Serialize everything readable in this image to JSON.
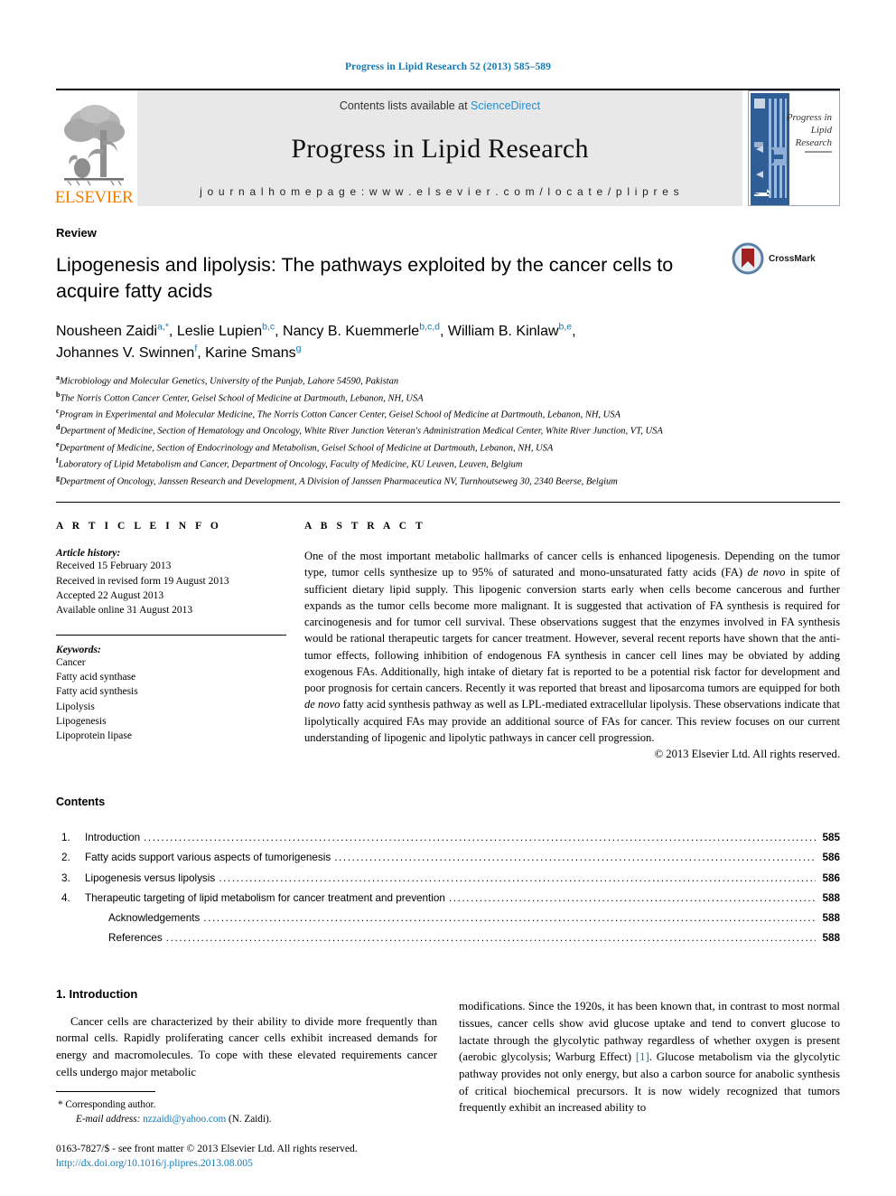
{
  "running_head": "Progress in Lipid Research 52 (2013) 585–589",
  "masthead": {
    "contents_prefix": "Contents lists available at ",
    "sciencedirect": "ScienceDirect",
    "journal_title": "Progress in Lipid Research",
    "homepage": "j o u r n a l   h o m e p a g e :   w w w . e l s e v i e r . c o m / l o c a t e / p l i p r e s",
    "publisher_word": "ELSEVIER",
    "cover_title_line1": "Progress in",
    "cover_title_line2": "Lipid",
    "cover_title_line3": "Research"
  },
  "article": {
    "doctype": "Review",
    "title": "Lipogenesis and lipolysis: The pathways exploited by the cancer cells to acquire fatty acids",
    "crossmark_label": "CrossMark",
    "authors": [
      {
        "name": "Nousheen Zaidi",
        "marks": "a,*",
        "sep": ", "
      },
      {
        "name": "Leslie Lupien",
        "marks": "b,c",
        "sep": ", "
      },
      {
        "name": "Nancy B. Kuemmerle",
        "marks": "b,c,d",
        "sep": ", "
      },
      {
        "name": "William B. Kinlaw",
        "marks": "b,e",
        "sep": ", "
      },
      {
        "name": "Johannes V. Swinnen",
        "marks": "f",
        "sep": ", "
      },
      {
        "name": "Karine Smans",
        "marks": "g",
        "sep": ""
      }
    ],
    "affiliations": [
      {
        "mark": "a",
        "text": "Microbiology and Molecular Genetics, University of the Punjab, Lahore 54590, Pakistan"
      },
      {
        "mark": "b",
        "text": "The Norris Cotton Cancer Center, Geisel School of Medicine at Dartmouth, Lebanon, NH, USA"
      },
      {
        "mark": "c",
        "text": "Program in Experimental and Molecular Medicine, The Norris Cotton Cancer Center, Geisel School of Medicine at Dartmouth, Lebanon, NH, USA"
      },
      {
        "mark": "d",
        "text": "Department of Medicine, Section of Hematology and Oncology, White River Junction Veteran's Administration Medical Center, White River Junction, VT, USA"
      },
      {
        "mark": "e",
        "text": "Department of Medicine, Section of Endocrinology and Metabolism, Geisel School of Medicine at Dartmouth, Lebanon, NH, USA"
      },
      {
        "mark": "f",
        "text": "Laboratory of Lipid Metabolism and Cancer, Department of Oncology, Faculty of Medicine, KU Leuven, Leuven, Belgium"
      },
      {
        "mark": "g",
        "text": "Department of Oncology, Janssen Research and Development, A Division of Janssen Pharmaceutica NV, Turnhoutseweg 30, 2340 Beerse, Belgium"
      }
    ]
  },
  "article_info": {
    "section_label": "A R T I C L E  I N F O",
    "history_title": "Article history:",
    "history": [
      "Received 15 February 2013",
      "Received in revised form 19 August 2013",
      "Accepted 22 August 2013",
      "Available online 31 August 2013"
    ],
    "keywords_title": "Keywords:",
    "keywords": [
      "Cancer",
      "Fatty acid synthase",
      "Fatty acid synthesis",
      "Lipolysis",
      "Lipogenesis",
      "Lipoprotein lipase"
    ]
  },
  "abstract": {
    "section_label": "A B S T R A C T",
    "part1": "One of the most important metabolic hallmarks of cancer cells is enhanced lipogenesis. Depending on the tumor type, tumor cells synthesize up to 95% of saturated and mono-unsaturated fatty acids (FA) ",
    "italic1": "de novo",
    "part2": " in spite of sufficient dietary lipid supply. This lipogenic conversion starts early when cells become cancerous and further expands as the tumor cells become more malignant. It is suggested that activation of FA synthesis is required for carcinogenesis and for tumor cell survival. These observations suggest that the enzymes involved in FA synthesis would be rational therapeutic targets for cancer treatment. However, several recent reports have shown that the anti-tumor effects, following inhibition of endogenous FA synthesis in cancer cell lines may be obviated by adding exogenous FAs. Additionally, high intake of dietary fat is reported to be a potential risk factor for development and poor prognosis for certain cancers. Recently it was reported that breast and liposarcoma tumors are equipped for both ",
    "italic2": "de novo",
    "part3": " fatty acid synthesis pathway as well as LPL-mediated extracellular lipolysis. These observations indicate that lipolytically acquired FAs may provide an additional source of FAs for cancer. This review focuses on our current understanding of lipogenic and lipolytic pathways in cancer cell progression.",
    "copyright": "© 2013 Elsevier Ltd. All rights reserved."
  },
  "contents": {
    "heading": "Contents",
    "rows": [
      {
        "num": "1.",
        "label": "Introduction",
        "page": "585",
        "indent": false
      },
      {
        "num": "2.",
        "label": "Fatty acids support various aspects of tumorigenesis",
        "page": "586",
        "indent": false
      },
      {
        "num": "3.",
        "label": "Lipogenesis versus lipolysis",
        "page": "586",
        "indent": false
      },
      {
        "num": "4.",
        "label": "Therapeutic targeting of lipid metabolism for cancer treatment and prevention",
        "page": "588",
        "indent": false
      },
      {
        "num": "",
        "label": "Acknowledgements",
        "page": "588",
        "indent": true
      },
      {
        "num": "",
        "label": "References",
        "page": "588",
        "indent": true
      }
    ]
  },
  "body": {
    "section_heading": "1. Introduction",
    "left_paragraph": "Cancer cells are characterized by their ability to divide more frequently than normal cells. Rapidly proliferating cancer cells exhibit increased demands for energy and macromolecules. To cope with these elevated requirements cancer cells undergo major metabolic",
    "right_part1": "modifications. Since the 1920s, it has been known that, in contrast to most normal tissues, cancer cells show avid glucose uptake and tend to convert glucose to lactate through the glycolytic pathway regardless of whether oxygen is present (aerobic glycolysis; Warburg Effect) ",
    "right_ref": "[1]",
    "right_part2": ". Glucose metabolism via the glycolytic pathway provides not only energy, but also a carbon source for anabolic synthesis of critical biochemical precursors. It is now widely recognized that tumors frequently exhibit an increased ability to"
  },
  "footnotes": {
    "corresponding_mark": "*",
    "corresponding_text": "Corresponding author.",
    "email_label": "E-mail address:",
    "email": "nzzaidi@yahoo.com",
    "email_suffix": " (N. Zaidi).",
    "imprint": "0163-7827/$ - see front matter © 2013 Elsevier Ltd. All rights reserved.",
    "doi": "http://dx.doi.org/10.1016/j.plipres.2013.08.005"
  },
  "colors": {
    "link_blue": "#1279b5",
    "sciencedirect_blue": "#1f8fd0",
    "elsevier_orange": "#f07d00",
    "masthead_gray": "#e8e8e8",
    "crossmark_red": "#a32020",
    "crossmark_ring": "#5a7fa5"
  }
}
